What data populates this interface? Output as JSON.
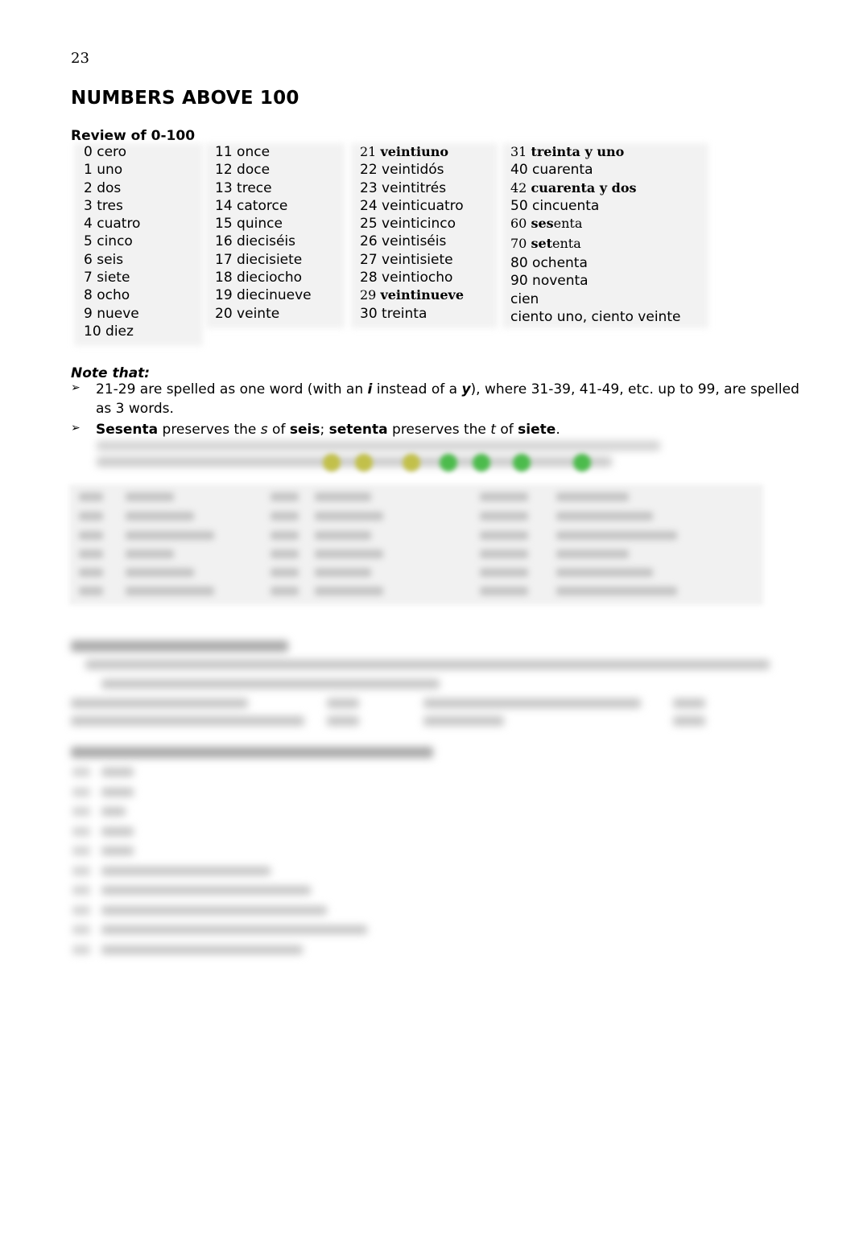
{
  "page": {
    "number": "23",
    "title": "NUMBERS ABOVE 100",
    "subtitle": "Review of 0-100"
  },
  "review_table": {
    "columns": [
      [
        {
          "num": "0",
          "word": "cero"
        },
        {
          "num": "1",
          "word": "uno"
        },
        {
          "num": "2",
          "word": "dos"
        },
        {
          "num": "3",
          "word": "tres"
        },
        {
          "num": "4",
          "word": "cuatro"
        },
        {
          "num": "5",
          "word": "cinco"
        },
        {
          "num": "6",
          "word": "seis"
        },
        {
          "num": "7",
          "word": "siete"
        },
        {
          "num": "8",
          "word": "ocho"
        },
        {
          "num": "9",
          "word": "nueve"
        },
        {
          "num": "10",
          "word": "diez"
        }
      ],
      [
        {
          "num": "11",
          "word": "once"
        },
        {
          "num": "12",
          "word": "doce"
        },
        {
          "num": "13",
          "word": "trece"
        },
        {
          "num": "14",
          "word": "catorce"
        },
        {
          "num": "15",
          "word": "quince"
        },
        {
          "num": "16",
          "word": "dieciséis"
        },
        {
          "num": "17",
          "word": "diecisiete"
        },
        {
          "num": "18",
          "word": "dieciocho"
        },
        {
          "num": "19",
          "word": "diecinueve"
        },
        {
          "num": "20",
          "word": " veinte"
        }
      ],
      [
        {
          "num": "21",
          "word": "veintiuno",
          "style": "serif-bold"
        },
        {
          "num": "22",
          "word": "veintidós"
        },
        {
          "num": "23",
          "word": "veintitrés"
        },
        {
          "num": "24",
          "word": "veinticuatro"
        },
        {
          "num": "25",
          "word": "veinticinco"
        },
        {
          "num": "26",
          "word": "veintiséis"
        },
        {
          "num": "27",
          "word": "veintisiete"
        },
        {
          "num": "28",
          "word": "veintiocho"
        },
        {
          "num": "29",
          "word": "veintinueve",
          "style": "serif-bold"
        },
        {
          "num": "30",
          "word": "treinta"
        }
      ],
      [
        {
          "num": "31",
          "word": "treinta y uno",
          "style": "serif-bold"
        },
        {
          "num": "40",
          "word": "cuarenta"
        },
        {
          "num": "42",
          "word": "cuarenta y dos",
          "style": "serif-bold"
        },
        {
          "num": "50",
          "word": "cincuenta"
        },
        {
          "num": "60",
          "word_bold": "ses",
          "word_rest": "enta",
          "style": "serif-partial"
        },
        {
          "num": "70",
          "word_bold": "set",
          "word_rest": "enta",
          "style": "serif-partial"
        },
        {
          "num": "80",
          "word": "ochenta"
        },
        {
          "num": "90",
          "word": "noventa"
        },
        {
          "num": "",
          "word": "cien"
        },
        {
          "num": "",
          "word": "ciento uno, ciento veinte"
        }
      ]
    ]
  },
  "notes": {
    "heading": "Note that:",
    "bullet_icon": "➢",
    "item1": {
      "t1": "21-29 are spelled as one word (with an ",
      "i": "i",
      "t2": " instead of a ",
      "y": "y",
      "t3": "), where 31-39, 41-49, etc. up to 99, are spelled as 3 words."
    },
    "item2": {
      "b1": "Sesenta",
      "t1": " preserves the ",
      "s": "s",
      "t2": " of ",
      "b2": "seis",
      "t3": "; ",
      "b3": "setenta",
      "t4": " preserves the ",
      "t": "t",
      "t5": " of ",
      "b4": "siete",
      "t6": "."
    }
  },
  "hidden_content": {
    "state": "blurred-preview",
    "dot_colors": [
      "#c2c04a",
      "#c2c04a",
      "#c2c04a",
      "#4cbb4c",
      "#4cbb4c",
      "#4cbb4c",
      "#4cbb4c"
    ]
  }
}
